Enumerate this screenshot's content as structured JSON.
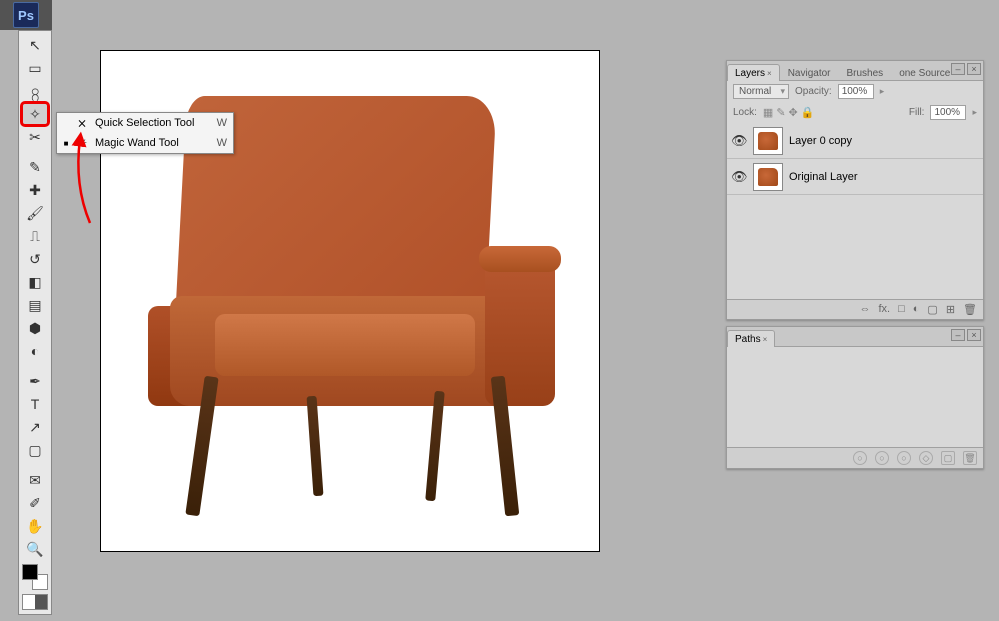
{
  "app": {
    "logo_text": "Ps"
  },
  "tools": [
    {
      "name": "move-tool",
      "glyph": "↖"
    },
    {
      "name": "marquee-tool",
      "glyph": "▭"
    },
    {
      "name": "lasso-tool",
      "glyph": "႙"
    },
    {
      "name": "quick-select-tool",
      "glyph": "✧",
      "selected": true
    },
    {
      "name": "crop-tool",
      "glyph": "✂"
    },
    {
      "name": "eyedropper-tool",
      "glyph": "✎"
    },
    {
      "name": "healing-brush-tool",
      "glyph": "✚"
    },
    {
      "name": "brush-tool",
      "glyph": "🖌"
    },
    {
      "name": "stamp-tool",
      "glyph": "⎍"
    },
    {
      "name": "history-brush-tool",
      "glyph": "↺"
    },
    {
      "name": "eraser-tool",
      "glyph": "◧"
    },
    {
      "name": "gradient-tool",
      "glyph": "▤"
    },
    {
      "name": "blur-tool",
      "glyph": "⬢"
    },
    {
      "name": "dodge-tool",
      "glyph": "◐"
    },
    {
      "name": "pen-tool",
      "glyph": "✒"
    },
    {
      "name": "type-tool",
      "glyph": "T"
    },
    {
      "name": "path-select-tool",
      "glyph": "↗"
    },
    {
      "name": "shape-tool",
      "glyph": "▢"
    },
    {
      "name": "notes-tool",
      "glyph": "✉"
    },
    {
      "name": "color-sampler-tool",
      "glyph": "✐"
    },
    {
      "name": "hand-tool",
      "glyph": "✋"
    },
    {
      "name": "zoom-tool",
      "glyph": "🔍"
    }
  ],
  "flyout": {
    "items": [
      {
        "icon": "⨯",
        "label": "Quick Selection Tool",
        "shortcut": "W",
        "active": false
      },
      {
        "icon": "✳",
        "label": "Magic Wand Tool",
        "shortcut": "W",
        "active": true
      }
    ]
  },
  "layers_panel": {
    "tabs": [
      "Layers",
      "Navigator",
      "Brushes",
      "one Source"
    ],
    "active_tab": 0,
    "blend_mode": "Normal",
    "opacity_label": "Opacity:",
    "opacity_value": "100%",
    "lock_label": "Lock:",
    "fill_label": "Fill:",
    "fill_value": "100%",
    "layers": [
      {
        "name": "Layer 0 copy"
      },
      {
        "name": "Original Layer"
      }
    ],
    "foot_icons": [
      "⇔",
      "fx.",
      "□",
      "◐",
      "▢",
      "⊞",
      "🗑"
    ]
  },
  "paths_panel": {
    "tabs": [
      "Paths"
    ],
    "foot_icons": [
      "○",
      "○",
      "○",
      "◇",
      "▢",
      "🗑"
    ]
  }
}
